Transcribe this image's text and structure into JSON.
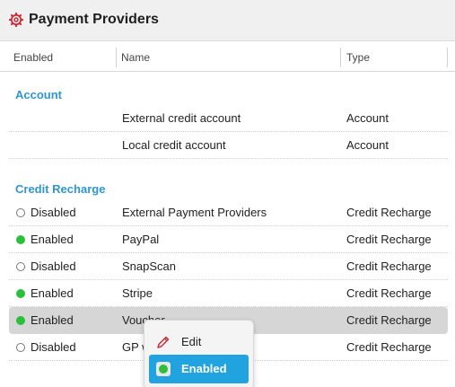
{
  "window": {
    "title": "Payment Providers",
    "icon": "gear-icon",
    "accent": "#c8303f"
  },
  "columns": {
    "enabled": "Enabled",
    "name": "Name",
    "type": "Type"
  },
  "sections": [
    {
      "title": "Account",
      "rows": [
        {
          "status": "",
          "name": "External credit account",
          "type": "Account"
        },
        {
          "status": "",
          "name": "Local credit account",
          "type": "Account"
        }
      ]
    },
    {
      "title": "Credit Recharge",
      "rows": [
        {
          "status": "Disabled",
          "name": "External Payment Providers",
          "type": "Credit Recharge"
        },
        {
          "status": "Enabled",
          "name": "PayPal",
          "type": "Credit Recharge"
        },
        {
          "status": "Disabled",
          "name": "SnapScan",
          "type": "Credit Recharge"
        },
        {
          "status": "Enabled",
          "name": "Stripe",
          "type": "Credit Recharge"
        },
        {
          "status": "Enabled",
          "name": "Voucher",
          "type": "Credit Recharge"
        },
        {
          "status": "Disabled",
          "name": "GP w",
          "type": "Credit Recharge"
        }
      ]
    }
  ],
  "context_menu": {
    "edit_label": "Edit",
    "enabled_label": "Enabled"
  },
  "colors": {
    "section": "#2f96d0",
    "enabled_dot": "#2bbf3c",
    "menu_highlight": "#21a3df"
  }
}
